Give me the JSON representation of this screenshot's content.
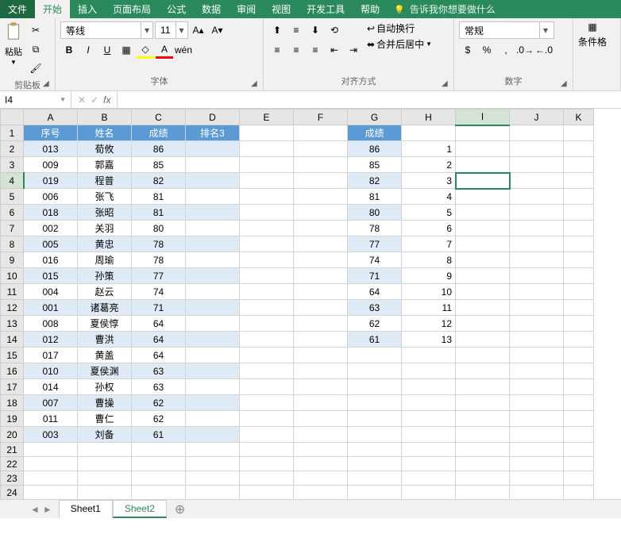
{
  "tabs": {
    "file": "文件",
    "home": "开始",
    "insert": "插入",
    "page_layout": "页面布局",
    "formulas": "公式",
    "data": "数据",
    "review": "审阅",
    "view": "视图",
    "dev": "开发工具",
    "help": "帮助",
    "tell_me": "告诉我你想要做什么"
  },
  "ribbon": {
    "clipboard": {
      "label": "剪贴板",
      "paste": "粘贴"
    },
    "font": {
      "label": "字体",
      "name": "等线",
      "size": "11"
    },
    "alignment": {
      "label": "对齐方式",
      "wrap": "自动换行",
      "merge": "合并后居中"
    },
    "number": {
      "label": "数字",
      "format": "常规"
    },
    "styles": {
      "cond_fmt": "条件格"
    }
  },
  "name_box": "I4",
  "formula_bar": "",
  "columns": [
    "A",
    "B",
    "C",
    "D",
    "E",
    "F",
    "G",
    "H",
    "I",
    "J",
    "K"
  ],
  "row_count": 24,
  "active_cell": {
    "row": 4,
    "col": "I"
  },
  "table1": {
    "headers": [
      "序号",
      "姓名",
      "成绩",
      "排名3"
    ],
    "rows": [
      [
        "013",
        "荀攸",
        "86",
        ""
      ],
      [
        "009",
        "郭嘉",
        "85",
        ""
      ],
      [
        "019",
        "程普",
        "82",
        ""
      ],
      [
        "006",
        "张飞",
        "81",
        ""
      ],
      [
        "018",
        "张昭",
        "81",
        ""
      ],
      [
        "002",
        "关羽",
        "80",
        ""
      ],
      [
        "005",
        "黄忠",
        "78",
        ""
      ],
      [
        "016",
        "周瑜",
        "78",
        ""
      ],
      [
        "015",
        "孙策",
        "77",
        ""
      ],
      [
        "004",
        "赵云",
        "74",
        ""
      ],
      [
        "001",
        "诸葛亮",
        "71",
        ""
      ],
      [
        "008",
        "夏侯惇",
        "64",
        ""
      ],
      [
        "012",
        "曹洪",
        "64",
        ""
      ],
      [
        "017",
        "黄盖",
        "64",
        ""
      ],
      [
        "010",
        "夏侯渊",
        "63",
        ""
      ],
      [
        "014",
        "孙权",
        "63",
        ""
      ],
      [
        "007",
        "曹操",
        "62",
        ""
      ],
      [
        "011",
        "曹仁",
        "62",
        ""
      ],
      [
        "003",
        "刘备",
        "61",
        ""
      ]
    ]
  },
  "table2": {
    "header": "成绩",
    "rows": [
      [
        "86",
        "1"
      ],
      [
        "85",
        "2"
      ],
      [
        "82",
        "3"
      ],
      [
        "81",
        "4"
      ],
      [
        "80",
        "5"
      ],
      [
        "78",
        "6"
      ],
      [
        "77",
        "7"
      ],
      [
        "74",
        "8"
      ],
      [
        "71",
        "9"
      ],
      [
        "64",
        "10"
      ],
      [
        "63",
        "11"
      ],
      [
        "62",
        "12"
      ],
      [
        "61",
        "13"
      ]
    ]
  },
  "sheets": [
    "Sheet1",
    "Sheet2"
  ],
  "active_sheet": "Sheet2"
}
